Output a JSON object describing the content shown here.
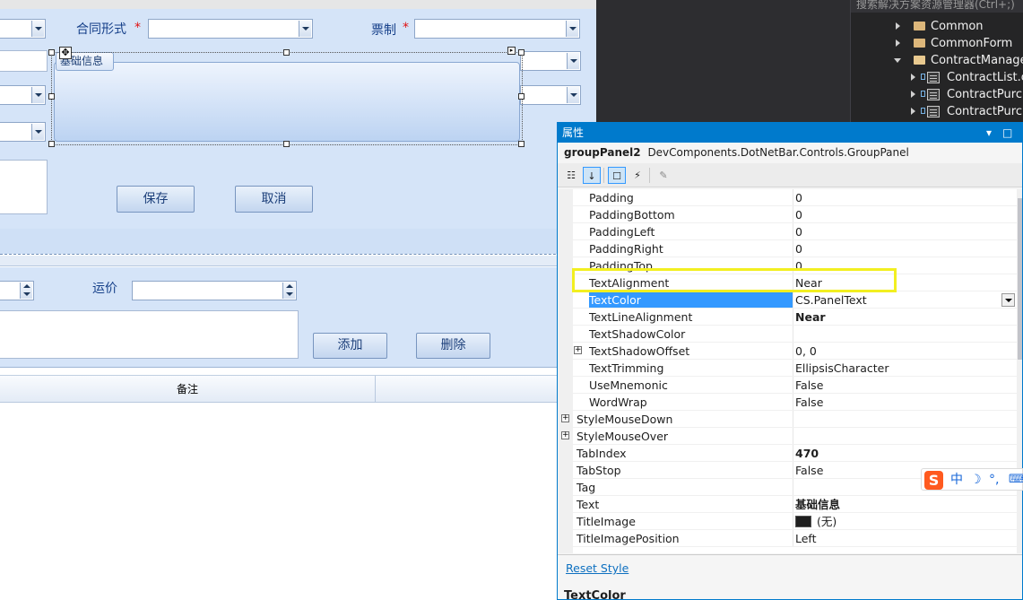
{
  "designer": {
    "labels": {
      "contract_form": "合同形式",
      "invoice_system": "票制",
      "required_mark": "*",
      "freight": "运价"
    },
    "group_panel_title": "基础信息",
    "buttons": {
      "save": "保存",
      "cancel": "取消",
      "add": "添加",
      "delete": "删除"
    },
    "grid_columns": [
      "备注"
    ]
  },
  "solution_explorer": {
    "search_placeholder": "搜索解决方案资源管理器(Ctrl+;)",
    "items": [
      {
        "label": "Common",
        "kind": "folder",
        "expanded": false
      },
      {
        "label": "CommonForm",
        "kind": "folder",
        "expanded": false
      },
      {
        "label": "ContractManage",
        "kind": "folder",
        "expanded": true
      },
      {
        "label": "ContractList.cs",
        "kind": "form"
      },
      {
        "label": "ContractPurcha",
        "kind": "form"
      },
      {
        "label": "ContractPurcha",
        "kind": "form"
      }
    ]
  },
  "properties": {
    "title": "属性",
    "object_name": "groupPanel2",
    "object_type": "DevComponents.DotNetBar.Controls.GroupPanel",
    "rows": [
      {
        "name": "Padding",
        "value": "0",
        "indent": 2
      },
      {
        "name": "PaddingBottom",
        "value": "0",
        "indent": 2
      },
      {
        "name": "PaddingLeft",
        "value": "0",
        "indent": 2
      },
      {
        "name": "PaddingRight",
        "value": "0",
        "indent": 2
      },
      {
        "name": "PaddingTop",
        "value": "0",
        "indent": 2
      },
      {
        "name": "TextAlignment",
        "value": "Near",
        "indent": 2
      },
      {
        "name": "TextColor",
        "value": "CS.PanelText",
        "indent": 2,
        "selected": true,
        "dropdown": true
      },
      {
        "name": "TextLineAlignment",
        "value": "Near",
        "indent": 2,
        "bold_value": true
      },
      {
        "name": "TextShadowColor",
        "value": "",
        "indent": 2
      },
      {
        "name": "TextShadowOffset",
        "value": "0, 0",
        "indent": 2,
        "expander": true
      },
      {
        "name": "TextTrimming",
        "value": "EllipsisCharacter",
        "indent": 2
      },
      {
        "name": "UseMnemonic",
        "value": "False",
        "indent": 2
      },
      {
        "name": "WordWrap",
        "value": "False",
        "indent": 2
      },
      {
        "name": "StyleMouseDown",
        "value": "",
        "indent": 1,
        "expander": true
      },
      {
        "name": "StyleMouseOver",
        "value": "",
        "indent": 1,
        "expander": true
      },
      {
        "name": "TabIndex",
        "value": "470",
        "indent": 1,
        "bold_value": true
      },
      {
        "name": "TabStop",
        "value": "False",
        "indent": 1
      },
      {
        "name": "Tag",
        "value": "",
        "indent": 1
      },
      {
        "name": "Text",
        "value": "基础信息",
        "indent": 1,
        "bold_value": true
      },
      {
        "name": "TitleImage",
        "value": "(无)",
        "indent": 1,
        "swatch": true
      },
      {
        "name": "TitleImagePosition",
        "value": "Left",
        "indent": 1
      }
    ],
    "reset_link": "Reset Style",
    "description_title": "TextColor"
  },
  "ime": {
    "logo": "S",
    "mode": "中",
    "moon": "☽",
    "punct": "°,"
  },
  "colors": {
    "vs_accent": "#007acc",
    "selection": "#3399ff",
    "highlight_box": "#f2ef20",
    "form_background": "#d5e4f8"
  }
}
